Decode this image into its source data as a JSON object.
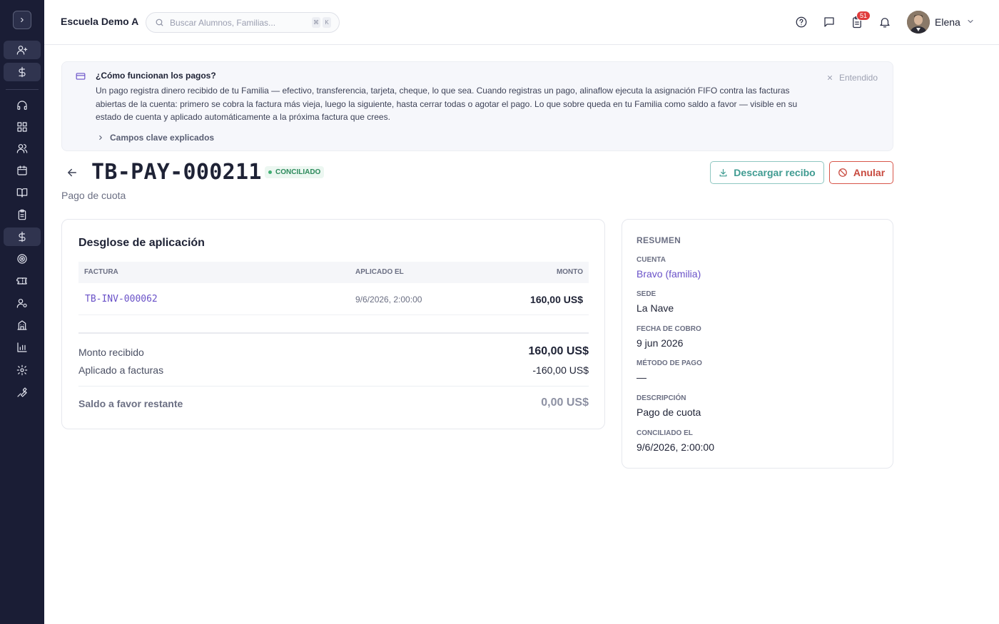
{
  "topbar": {
    "school_name": "Escuela Demo A",
    "search_placeholder": "Buscar Alumnos, Familias...",
    "kbd_mod": "⌘",
    "kbd_key": "K",
    "notification_count": "51",
    "user_name": "Elena"
  },
  "sidebar": {
    "items": [
      "toggle",
      "add-user",
      "dollar",
      "headset",
      "grid",
      "users",
      "calendar",
      "book",
      "clipboard",
      "dollar-active",
      "target",
      "ticket",
      "user-gear",
      "building",
      "chart",
      "settings",
      "wrench"
    ]
  },
  "banner": {
    "title": "¿Cómo funcionan los pagos?",
    "body": "Un pago registra dinero recibido de tu Familia — efectivo, transferencia, tarjeta, cheque, lo que sea. Cuando registras un pago, alinaflow ejecuta la asignación FIFO contra las facturas abiertas de la cuenta: primero se cobra la factura más vieja, luego la siguiente, hasta cerrar todas o agotar el pago. Lo que sobre queda en tu Familia como saldo a favor — visible en su estado de cuenta y aplicado automáticamente a la próxima factura que crees.",
    "link": "Campos clave explicados",
    "dismiss": "Entendido"
  },
  "header": {
    "title": "TB-PAY-000211",
    "status": "CONCILIADO",
    "subtitle": "Pago de cuota",
    "download_label": "Descargar recibo",
    "void_label": "Anular"
  },
  "breakdown": {
    "title": "Desglose de aplicación",
    "columns": [
      "FACTURA",
      "APLICADO EL",
      "MONTO"
    ],
    "rows": [
      {
        "invoice": "TB-INV-000062",
        "applied_on": "9/6/2026, 2:00:00",
        "amount": "160,00 US$"
      }
    ],
    "received_label": "Monto recibido",
    "received_value": "160,00 US$",
    "applied_label": "Aplicado a facturas",
    "applied_value": "-160,00 US$",
    "credit_label": "Saldo a favor restante",
    "credit_value": "0,00 US$"
  },
  "summary": {
    "heading": "RESUMEN",
    "fields": [
      {
        "label": "CUENTA",
        "value": "Bravo (familia)"
      },
      {
        "label": "SEDE",
        "value": "La Nave"
      },
      {
        "label": "FECHA DE COBRO",
        "value": "9 jun 2026"
      },
      {
        "label": "MÉTODO DE PAGO",
        "value": "—"
      },
      {
        "label": "DESCRIPCIÓN",
        "value": "Pago de cuota"
      },
      {
        "label": "CONCILIADO EL",
        "value": "9/6/2026, 2:00:00"
      }
    ]
  },
  "colors": {
    "sidebar_bg": "#1a1d35",
    "accent_link": "#6a52c8",
    "status_green": "#2c8a5b",
    "download_teal": "#3f9b91",
    "void_red": "#c84a3f",
    "badge_red": "#e03b3b"
  }
}
